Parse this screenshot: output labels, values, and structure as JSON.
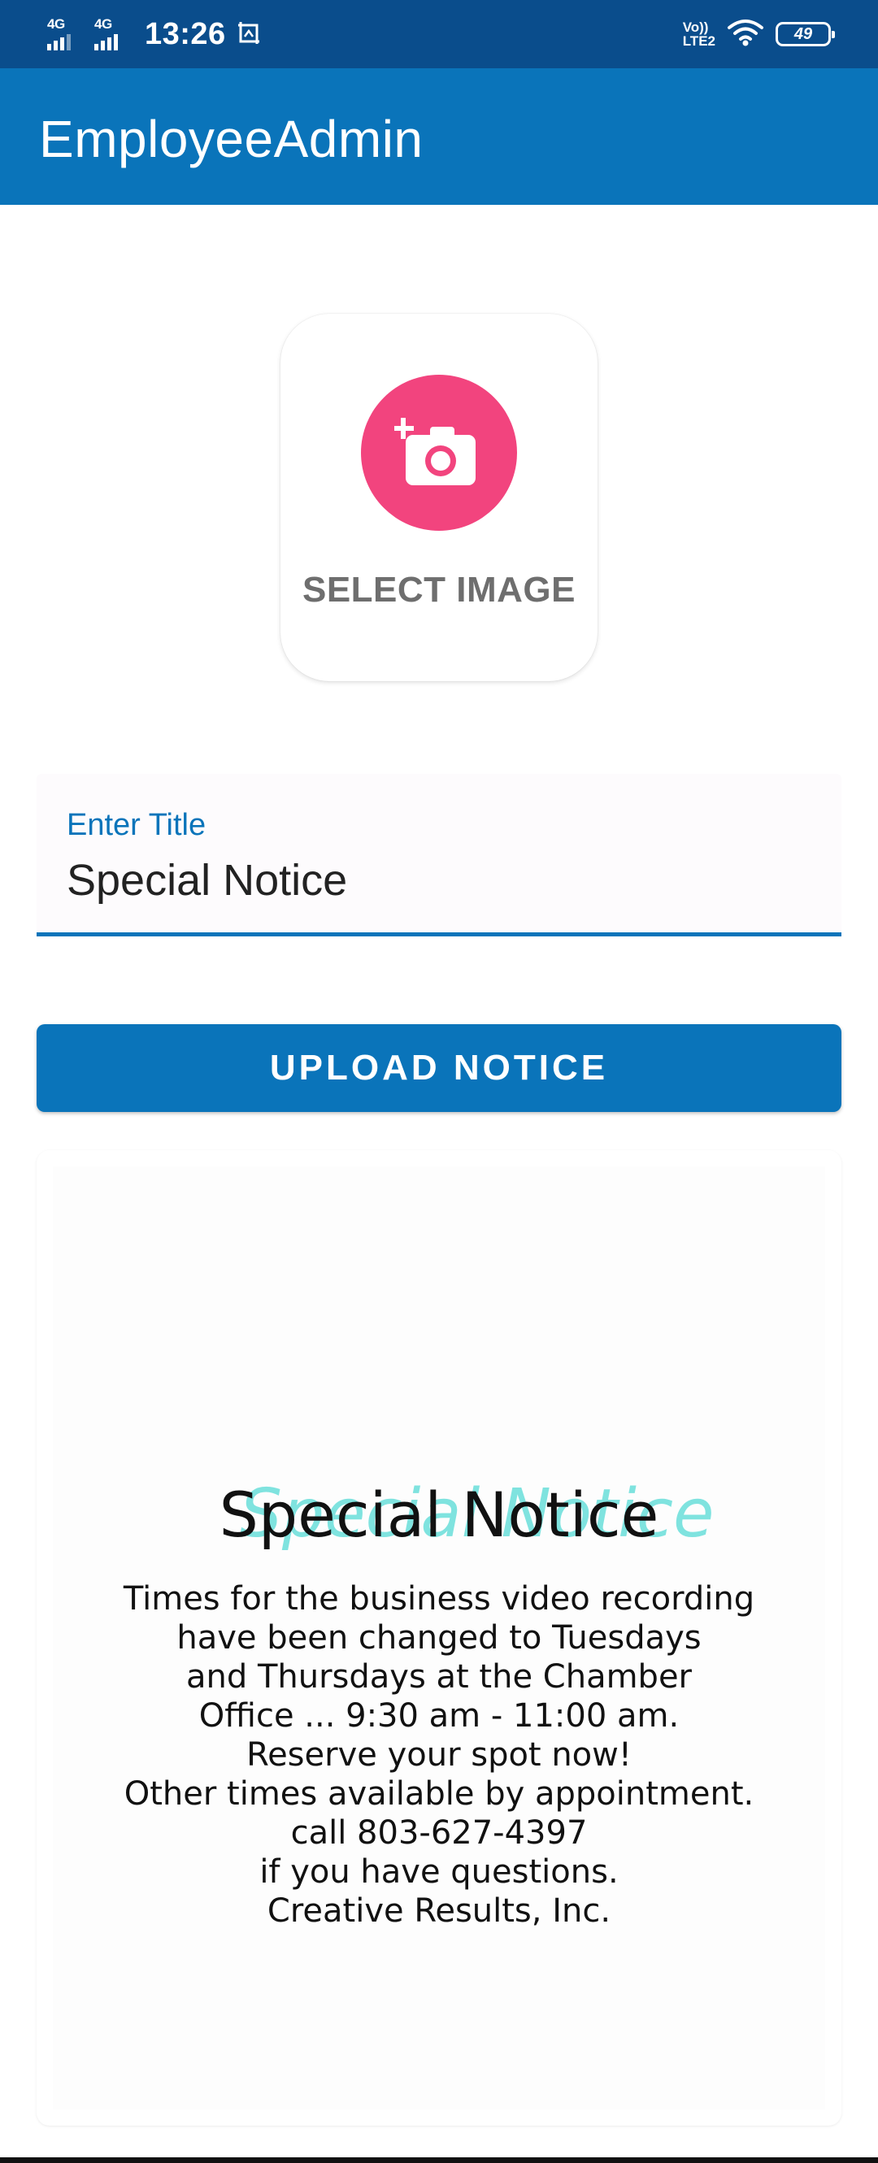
{
  "status_bar": {
    "network1": "4G",
    "network2": "4G",
    "time": "13:26",
    "volte_line1": "Vo))",
    "volte_line2": "LTE2",
    "battery": "49"
  },
  "app_bar": {
    "title": "EmployeeAdmin"
  },
  "select_image": {
    "label": "SELECT IMAGE",
    "icon": "add-a-photo-icon",
    "accent_color": "#f2447e"
  },
  "title_field": {
    "label": "Enter Title",
    "value": "Special Notice"
  },
  "upload_button": {
    "label": "UPLOAD NOTICE"
  },
  "notice_preview": {
    "watermark": "Special Notice",
    "heading": "Special Notice",
    "lines": [
      "Times for the business video recording",
      "have been changed to Tuesdays",
      "and Thursdays at the Chamber",
      "Office ... 9:30 am - 11:00 am.",
      "Reserve your spot now!",
      "Other times available by appointment.",
      "call 803-627-4397",
      "if you have questions.",
      "Creative Results, Inc."
    ]
  },
  "colors": {
    "primary": "#0a74ba",
    "status_bar": "#0a4d8c",
    "accent": "#f2447e"
  }
}
